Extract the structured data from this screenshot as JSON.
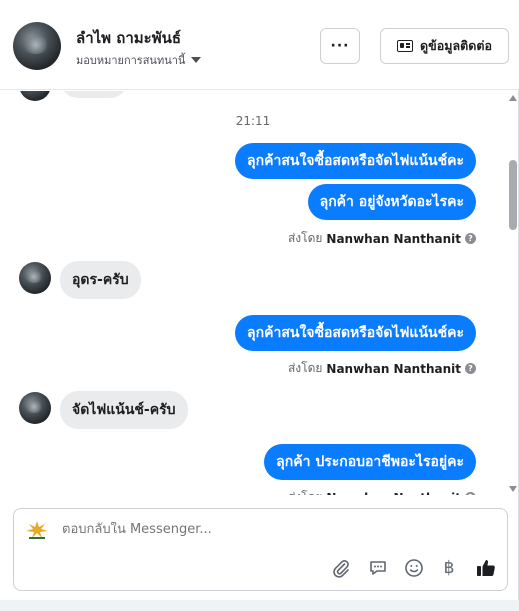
{
  "header": {
    "name": "ลำไพ ถามะพันธ์",
    "assigned": "มอบหมายการสนทนานี้",
    "contact_button": "ดูข้อมูลติดต่อ",
    "more_label": "···"
  },
  "thread": {
    "timestamp": "21:11",
    "messages": [
      {
        "from": "page",
        "text": "ลุกค้าสนใจซื้อสดหรือจัดไฟแน้นช์คะ"
      },
      {
        "from": "page",
        "text": "ลุกค้า  อยู่จังหวัดอะไรคะ"
      },
      {
        "from": "customer",
        "text": "อุดร-ครับ"
      },
      {
        "from": "page",
        "text": "ลุกค้าสนใจซื้อสดหรือจัดไฟแน้นช์คะ"
      },
      {
        "from": "customer",
        "text": "จัดไฟแน้นช์-ครับ"
      },
      {
        "from": "page",
        "text": "ลุกค้า ประกอบอาชีพอะไรอยู่คะ"
      }
    ],
    "sent_by_label": "ส่งโดย",
    "sent_by_name": "Nanwhan Nanthanit",
    "help_glyph": "?"
  },
  "reply": {
    "placeholder": "ตอบกลับใน Messenger..."
  },
  "toolbar": {
    "icons": [
      "attachment-icon",
      "saved-replies-icon",
      "emoji-icon",
      "baht-payment-icon",
      "like-icon"
    ],
    "baht_glyph": "฿"
  },
  "colors": {
    "outgoing_bubble": "#0a7cff",
    "incoming_bubble": "#eaebed"
  }
}
